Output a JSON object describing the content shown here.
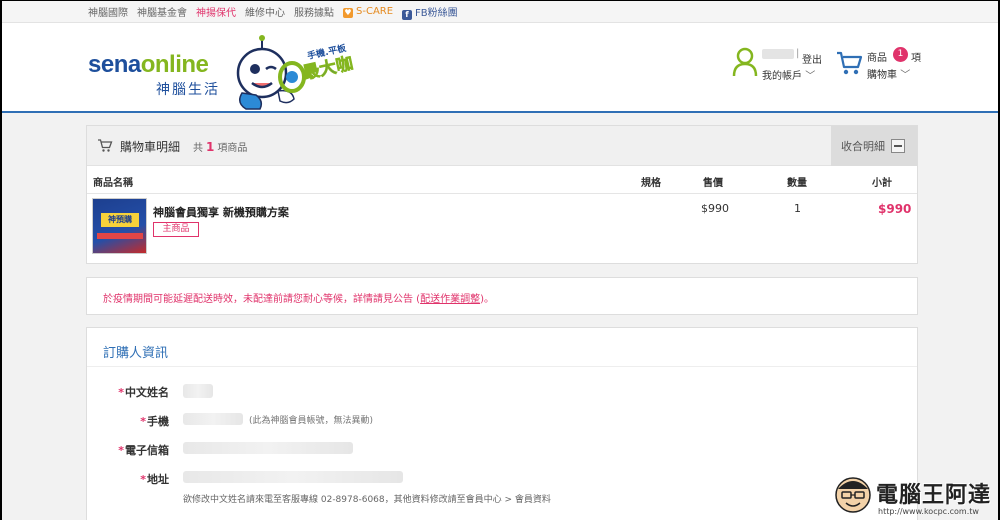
{
  "topbar": {
    "links": [
      "神腦國際",
      "神腦基金會",
      "神揚保代",
      "維修中心",
      "服務據點"
    ],
    "scare": "S-CARE",
    "fb": "FB粉絲團"
  },
  "header": {
    "logo_sena": "sena",
    "logo_online": "online",
    "logo_sub": "神腦生活",
    "mascot_badge_top": "手機.平板",
    "mascot_badge_main": "最大咖",
    "logout": "登出",
    "sep": "|",
    "my_account": "我的帳戶",
    "cart_items_label": "商品",
    "cart_count": "1",
    "cart_items_unit": "項",
    "cart_label": "購物車"
  },
  "cart": {
    "title": "購物車明細",
    "count_prefix": "共",
    "count": "1",
    "count_suffix": "項商品",
    "collapse": "收合明細",
    "columns": {
      "name": "商品名稱",
      "spec": "規格",
      "price": "售價",
      "qty": "數量",
      "subtotal": "小計"
    },
    "items": [
      {
        "name": "神腦會員獨享 新機預購方案",
        "tag": "主商品",
        "thumb_text": "神預購",
        "price": "$990",
        "qty": "1",
        "subtotal": "$990"
      }
    ]
  },
  "notice": {
    "text_before": "於疫情期間可能延遲配送時效，未配達前請您耐心等候，詳情請見公告 (",
    "link": "配送作業調整",
    "text_after": ")。"
  },
  "buyer": {
    "title": "訂購人資訊",
    "fields": {
      "name_label": "中文姓名",
      "phone_label": "手機",
      "phone_hint": "(此為神腦會員帳號，無法異動)",
      "email_label": "電子信箱",
      "address_label": "地址"
    },
    "note": "欲修改中文姓名請來電至客服專線 02-8978-6068，其他資料修改請至會員中心 > 會員資料"
  },
  "watermark": {
    "brand": "電腦王阿達",
    "url": "http://www.kocpc.com.tw"
  },
  "colors": {
    "brand_blue": "#1e4f9c",
    "brand_green": "#84b61f",
    "accent_pink": "#e0336b",
    "section_blue": "#2f6fb5"
  }
}
